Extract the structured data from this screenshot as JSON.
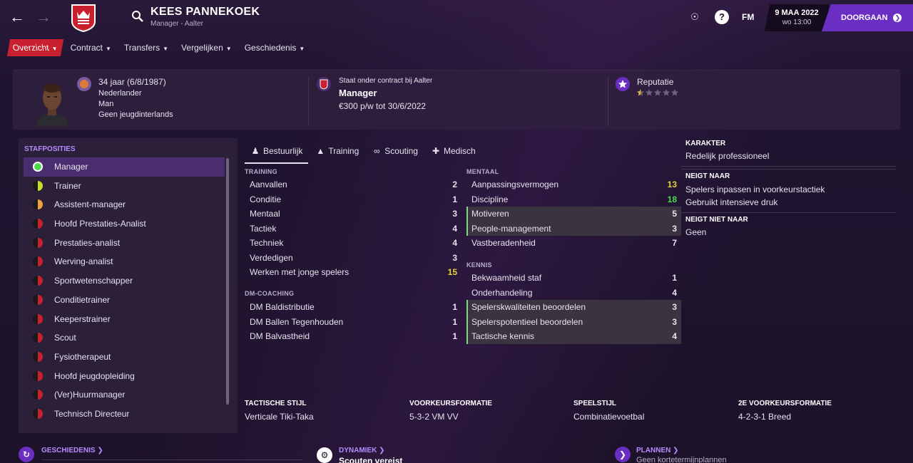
{
  "colors": {
    "accent": "#6a2fc2",
    "active_tab": "#c8202e",
    "highlight_green": "#7ed686",
    "yellow": "#e8d23a",
    "purple_hdr": "#b58cff"
  },
  "topbar": {
    "name": "KEES PANNEKOEK",
    "subtitle": "Manager - Aalter",
    "fm": "FM",
    "date": "9 MAA 2022",
    "time": "wo 13:00",
    "continue": "DOORGAAN"
  },
  "menu": [
    {
      "label": "Overzicht"
    },
    {
      "label": "Contract"
    },
    {
      "label": "Transfers"
    },
    {
      "label": "Vergelijken"
    },
    {
      "label": "Geschiedenis"
    }
  ],
  "profile": {
    "age": "34 jaar (6/8/1987)",
    "nationality": "Nederlander",
    "gender": "Man",
    "intl": "Geen jeugdinterlands",
    "contract_label": "Staat onder contract bij Aalter",
    "role": "Manager",
    "wage": "€300 p/w tot 30/6/2022",
    "reputation_label": "Reputatie",
    "reputation_stars": 0.5
  },
  "staff": {
    "title": "STAFPOSITIES",
    "items": [
      {
        "label": "Manager",
        "dot": "green"
      },
      {
        "label": "Trainer",
        "dot": "yellowgreen"
      },
      {
        "label": "Assistent-manager",
        "dot": "orange"
      },
      {
        "label": "Hoofd Prestaties-Analist",
        "dot": "red"
      },
      {
        "label": "Prestaties-analist",
        "dot": "red"
      },
      {
        "label": "Werving-analist",
        "dot": "red"
      },
      {
        "label": "Sportwetenschapper",
        "dot": "red"
      },
      {
        "label": "Conditietrainer",
        "dot": "red"
      },
      {
        "label": "Keeperstrainer",
        "dot": "red"
      },
      {
        "label": "Scout",
        "dot": "red"
      },
      {
        "label": "Fysiotherapeut",
        "dot": "red"
      },
      {
        "label": "Hoofd jeugdopleiding",
        "dot": "red"
      },
      {
        "label": "(Ver)Huurmanager",
        "dot": "red"
      },
      {
        "label": "Technisch Directeur",
        "dot": "red"
      }
    ]
  },
  "attr_tabs": [
    {
      "label": "Bestuurlijk",
      "icon": "person-icon"
    },
    {
      "label": "Training",
      "icon": "training-icon"
    },
    {
      "label": "Scouting",
      "icon": "binoculars-icon"
    },
    {
      "label": "Medisch",
      "icon": "medical-icon"
    }
  ],
  "training": {
    "title": "TRAINING",
    "rows": [
      {
        "label": "Aanvallen",
        "value": "2"
      },
      {
        "label": "Conditie",
        "value": "1"
      },
      {
        "label": "Mentaal",
        "value": "3"
      },
      {
        "label": "Tactiek",
        "value": "4"
      },
      {
        "label": "Techniek",
        "value": "4"
      },
      {
        "label": "Verdedigen",
        "value": "3"
      },
      {
        "label": "Werken met jonge spelers",
        "value": "15"
      }
    ]
  },
  "dm": {
    "title": "DM-COACHING",
    "rows": [
      {
        "label": "DM Baldistributie",
        "value": "1"
      },
      {
        "label": "DM Ballen Tegenhouden",
        "value": "1"
      },
      {
        "label": "DM Balvastheid",
        "value": "1"
      }
    ]
  },
  "mentaal": {
    "title": "MENTAAL",
    "rows": [
      {
        "label": "Aanpassingsvermogen",
        "value": "13"
      },
      {
        "label": "Discipline",
        "value": "18"
      },
      {
        "label": "Motiveren",
        "value": "5"
      },
      {
        "label": "People-management",
        "value": "3"
      },
      {
        "label": "Vastberadenheid",
        "value": "7"
      }
    ]
  },
  "kennis": {
    "title": "KENNIS",
    "rows": [
      {
        "label": "Bekwaamheid staf",
        "value": "1"
      },
      {
        "label": "Onderhandeling",
        "value": "4"
      },
      {
        "label": "Spelerskwaliteiten beoordelen",
        "value": "3"
      },
      {
        "label": "Spelerspotentieel beoordelen",
        "value": "3"
      },
      {
        "label": "Tactische kennis",
        "value": "4"
      }
    ]
  },
  "right": {
    "karakter_hdr": "KARAKTER",
    "karakter": "Redelijk professioneel",
    "neigt_hdr": "NEIGT NAAR",
    "neigt1": "Spelers inpassen in voorkeurstactiek",
    "neigt2": "Gebruikt intensieve druk",
    "neigt_niet_hdr": "NEIGT NIET NAAR",
    "neigt_niet": "Geen"
  },
  "style": {
    "tactiek_hdr": "TACTISCHE STIJL",
    "tactiek": "Verticale Tiki-Taka",
    "formatie_hdr": "VOORKEURSFORMATIE",
    "formatie": "5-3-2 VM VV",
    "speelstijl_hdr": "SPEELSTIJL",
    "speelstijl": "Combinatievoetbal",
    "formatie2_hdr": "2E VOORKEURSFORMATIE",
    "formatie2": "4-2-3-1 Breed"
  },
  "bottom": {
    "geschiedenis": "GESCHIEDENIS",
    "dynamiek": "DYNAMIEK",
    "dynamiek_txt": "Scouten vereist",
    "plannen": "PLANNEN",
    "plannen_txt": "Geen kortetermijnplannen"
  }
}
